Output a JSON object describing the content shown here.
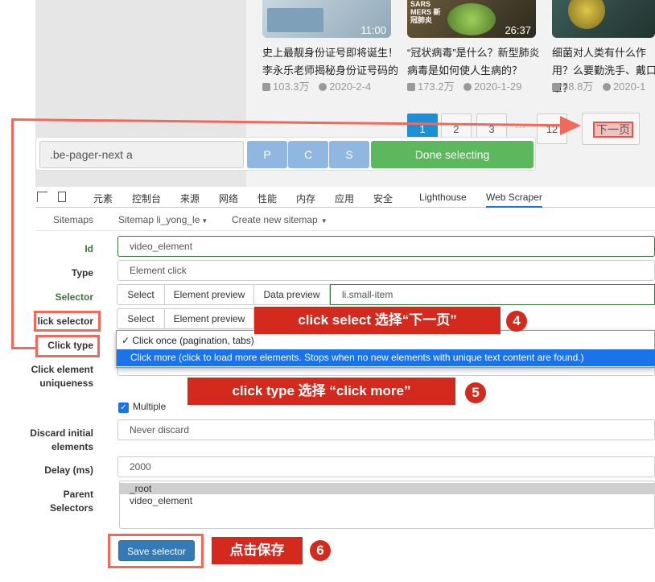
{
  "videos": [
    {
      "duration": "11:00",
      "title": "史上最靓身份证号即将诞生！李永乐老师揭秘身份证号码的",
      "views": "103.3万",
      "date": "2020-2-4"
    },
    {
      "duration": "26:37",
      "title": "“冠状病毒”是什么？新型肺炎病毒是如何使人生病的？",
      "views": "173.2万",
      "date": "2020-1-29",
      "thumb_text": "SARS MERS 新冠肺炎"
    },
    {
      "duration": "",
      "title": "细菌对人类有什么作用？么要勤洗手、戴口罩？",
      "views": "58.8万",
      "date": "2020-1"
    }
  ],
  "pager": {
    "pages": [
      "1",
      "2",
      "3",
      "···",
      "12"
    ],
    "active": "1",
    "next_label": "下一页"
  },
  "selector_bar": {
    "value": ".be-pager-next a",
    "btn_p": "P",
    "btn_c": "C",
    "btn_s": "S",
    "done": "Done selecting"
  },
  "devtools_tabs": [
    "元素",
    "控制台",
    "来源",
    "网络",
    "性能",
    "内存",
    "应用",
    "安全",
    "Lighthouse",
    "Web Scraper"
  ],
  "ws_nav": {
    "sitemaps": "Sitemaps",
    "sitemap": "Sitemap li_yong_le",
    "create": "Create new sitemap"
  },
  "form": {
    "id_label": "Id",
    "id_value": "video_element",
    "type_label": "Type",
    "type_value": "Element click",
    "selector_label": "Selector",
    "btn_select": "Select",
    "btn_preview": "Element preview",
    "btn_data_preview": "Data preview",
    "selector_value": "li.small-item",
    "click_selector_label": "lick selector",
    "click_type_label": "Click type",
    "click_once": "✓ Click once (pagination, tabs)",
    "click_more": "Click more (click to load more elements. Stops when no new elements with unique text content are found.)",
    "uniqueness_label_1": "Click element",
    "uniqueness_label_2": "uniqueness",
    "multiple_label": "Multiple",
    "discard_label_1": "Discard initial",
    "discard_label_2": "elements",
    "discard_value": "Never discard",
    "delay_label": "Delay (ms)",
    "delay_value": "2000",
    "parent_label_1": "Parent",
    "parent_label_2": "Selectors",
    "parents": [
      "_root",
      "video_element"
    ],
    "save": "Save selector"
  },
  "annotations": {
    "step4": "click select 选择“下一页”",
    "num4": "4",
    "step5": "click type 选择 “click more”",
    "num5": "5",
    "step6": "点击保存",
    "num6": "6"
  },
  "colors": {
    "annotation_red": "#d42a1e",
    "outline_red": "#ef6a5a",
    "done_green": "#5cb85c",
    "save_blue": "#337ab7"
  }
}
